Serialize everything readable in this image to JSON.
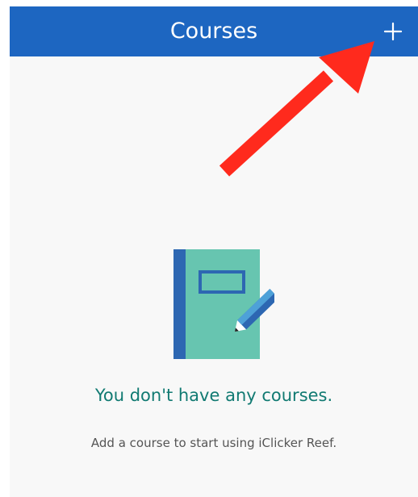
{
  "header": {
    "title": "Courses",
    "add_icon": "plus-icon"
  },
  "empty_state": {
    "icon": "notebook-pencil-icon",
    "title": "You don't have any courses.",
    "subtitle": "Add a course to start using iClicker Reef."
  },
  "annotation": {
    "icon": "red-arrow-icon"
  },
  "colors": {
    "header_bg": "#1d66c1",
    "background": "#f8f8f8",
    "title_teal": "#117a72",
    "notebook_green": "#67c5b0",
    "notebook_spine": "#2d67b2",
    "arrow_red": "#ff2a1d"
  }
}
